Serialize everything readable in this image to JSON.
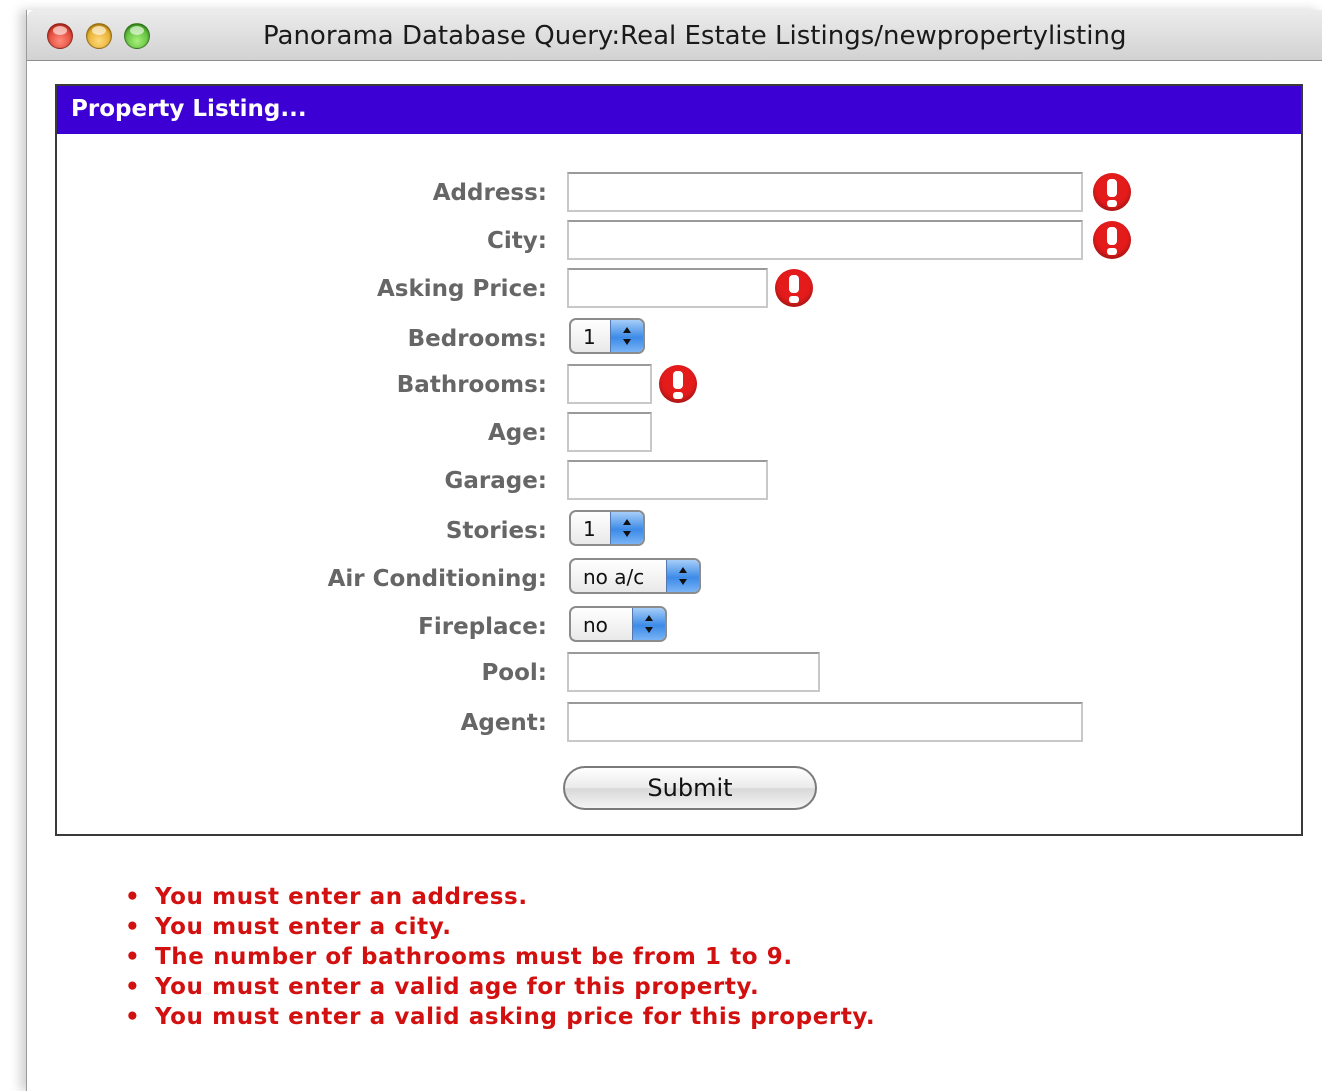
{
  "window": {
    "title": "Panorama Database Query:Real Estate Listings/newpropertylisting"
  },
  "panel": {
    "title": "Property Listing..."
  },
  "form": {
    "address": {
      "label": "Address:",
      "value": ""
    },
    "city": {
      "label": "City:",
      "value": ""
    },
    "asking_price": {
      "label": "Asking Price:",
      "value": ""
    },
    "bedrooms": {
      "label": "Bedrooms:",
      "selected": "1"
    },
    "bathrooms": {
      "label": "Bathrooms:",
      "value": ""
    },
    "age": {
      "label": "Age:",
      "value": ""
    },
    "garage": {
      "label": "Garage:",
      "value": ""
    },
    "stories": {
      "label": "Stories:",
      "selected": "1"
    },
    "air_conditioning": {
      "label": "Air Conditioning:",
      "selected": "no a/c"
    },
    "fireplace": {
      "label": "Fireplace:",
      "selected": "no"
    },
    "pool": {
      "label": "Pool:",
      "value": ""
    },
    "agent": {
      "label": "Agent:",
      "value": ""
    },
    "submit_label": "Submit"
  },
  "errors": [
    "You must enter an address.",
    "You must enter a city.",
    "The number of bathrooms must be from 1 to 9.",
    "You must enter a valid age for this property.",
    "You must enter a valid asking price for this property."
  ],
  "colors": {
    "header_bg": "#3d00d4",
    "error_text": "#d21010",
    "label_text": "#666666"
  },
  "icons": {
    "validation": "exclamation-alert-icon"
  }
}
